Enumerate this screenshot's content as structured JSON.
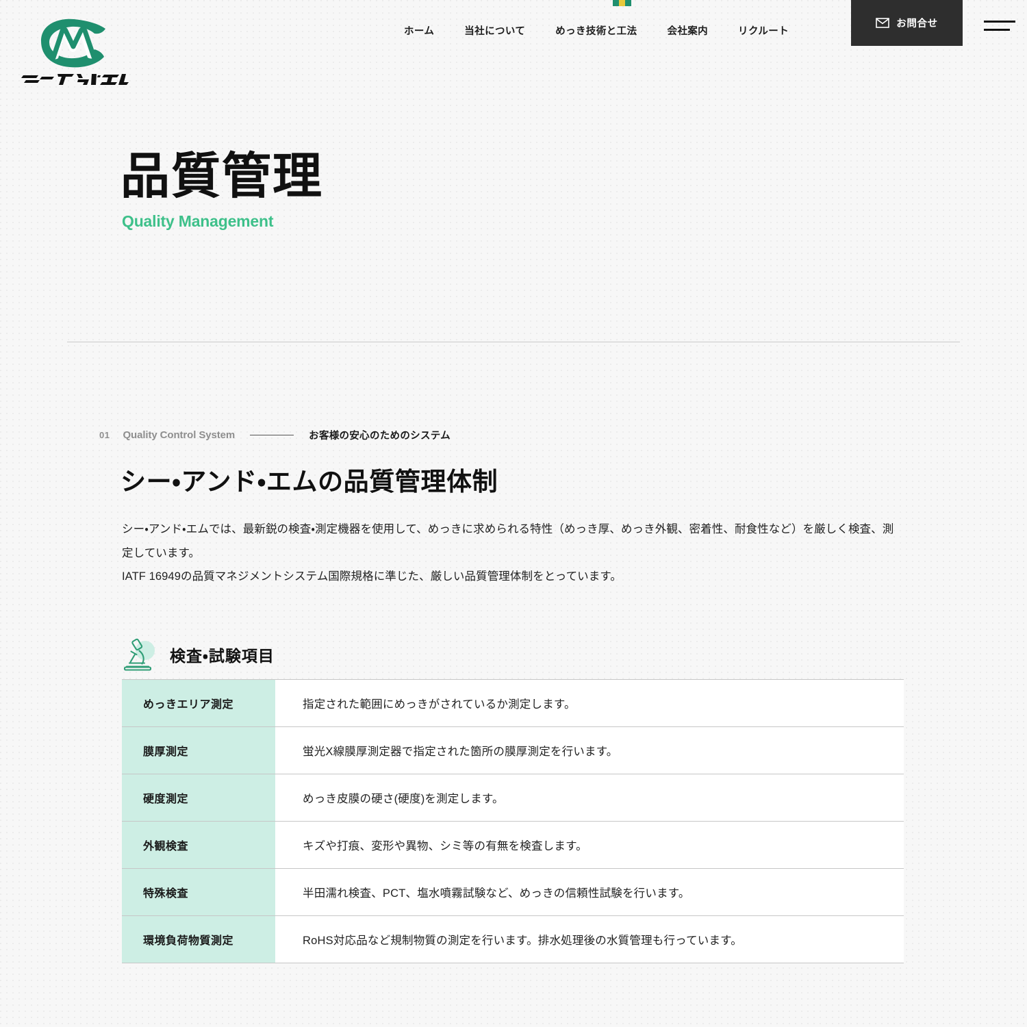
{
  "accent": {
    "brand_green": "#1f8f6e",
    "mint": "#3ec08a",
    "mint_bg": "#cdeee4",
    "dark": "#2e2e2e",
    "bars": [
      "green",
      "yellow",
      "green"
    ]
  },
  "header": {
    "logo_alt": "シー・アンド・エム",
    "logo_wordmark": "シー・アンド・エム",
    "nav": [
      {
        "label": "ホーム"
      },
      {
        "label": "当社について"
      },
      {
        "label": "めっき技術と工法"
      },
      {
        "label": "会社案内"
      },
      {
        "label": "リクルート"
      }
    ],
    "contact_label": "お問合せ",
    "contact_icon": "mail-icon",
    "menu_icon": "hamburger-menu-icon"
  },
  "hero": {
    "title": "品質管理",
    "subtitle": "Quality Management"
  },
  "section": {
    "eyebrow_number": "01",
    "eyebrow_en": "Quality Control System",
    "eyebrow_jp": "お客様の安心のためのシステム",
    "heading": "シー・アンド・エムの品質管理体制",
    "lead_p1": "シー・アンド・エムでは、最新鋭の検査・測定機器を使用して、めっきに求められる特性（めっき厚、めっき外観、密着性、耐食性など）を厳しく検査、測定しています。",
    "lead_p2": "IATF 16949の品質マネジメントシステム国際規格に準じた、厳しい品質管理体制をとっています。"
  },
  "subblock": {
    "icon": "microscope-icon",
    "title": "検査・試験項目",
    "rows": [
      {
        "label": "めっきエリア測定",
        "description": "指定された範囲にめっきがされているか測定します。"
      },
      {
        "label": "膜厚測定",
        "description": "蛍光X線膜厚測定器で指定された箇所の膜厚測定を行います。"
      },
      {
        "label": "硬度測定",
        "description": "めっき皮膜の硬さ(硬度)を測定します。"
      },
      {
        "label": "外観検査",
        "description": "キズや打痕、変形や異物、シミ等の有無を検査します。"
      },
      {
        "label": "特殊検査",
        "description": "半田濡れ検査、PCT、塩水噴霧試験など、めっきの信頼性試験を行います。"
      },
      {
        "label": "環境負荷物質測定",
        "description": "RoHS対応品など規制物質の測定を行います。排水処理後の水質管理も行っています。"
      }
    ]
  }
}
